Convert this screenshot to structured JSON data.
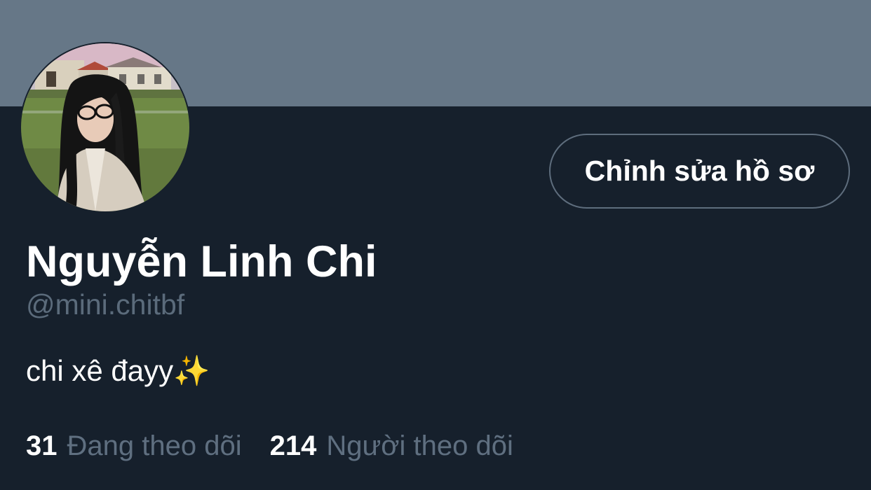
{
  "profile": {
    "display_name": "Nguyễn Linh Chi",
    "handle": "@mini.chitbf",
    "bio": "chi xê đayy✨",
    "edit_button_label": "Chỉnh sửa hồ sơ",
    "stats": {
      "following_count": "31",
      "following_label": "Đang theo dõi",
      "followers_count": "214",
      "followers_label": "Người theo dõi"
    }
  },
  "colors": {
    "banner": "#667787",
    "background": "#16202c",
    "muted_text": "#5b6b7b",
    "button_border": "#5e6d7d"
  },
  "icons": {
    "avatar": "profile-photo"
  }
}
